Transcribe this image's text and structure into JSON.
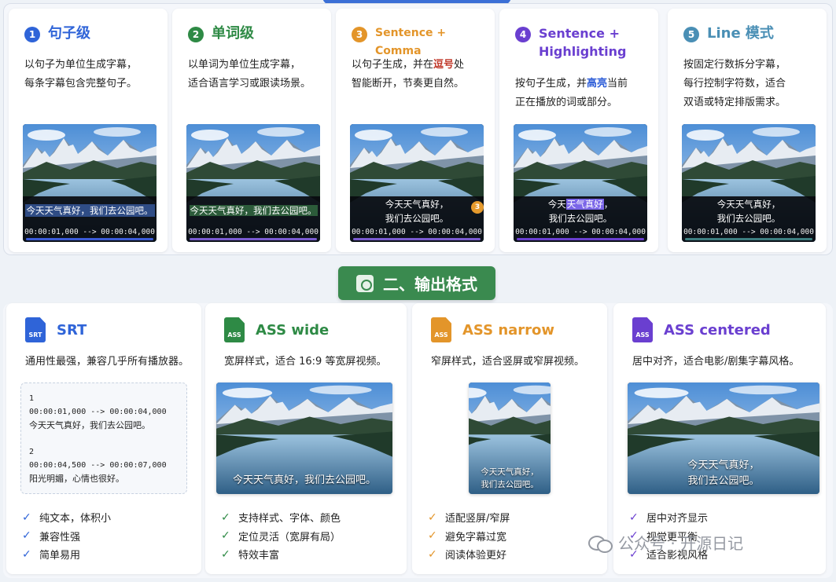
{
  "modes": [
    {
      "num": "1",
      "title": "句子级",
      "color": "#2f64d8",
      "title_size": 18,
      "desc": [
        "以句子为单位生成字幕，",
        "每条字幕包含完整句子。"
      ],
      "subs": [
        "今天天气真好，我们去公园吧。"
      ],
      "time": "00:00:01,000 --> 00:00:04,000",
      "bar": "#3b5bd6"
    },
    {
      "num": "2",
      "title": "单词级",
      "color": "#2e8a45",
      "title_size": 18,
      "desc_rich": [
        [
          "以单词为",
          "",
          ""
        ],
        [
          "单位生成字幕",
          "dark",
          ""
        ],
        [
          "，",
          "",
          ""
        ]
      ],
      "desc": [
        "以单词为单位生成字幕，",
        "适合语言学习或跟读场景。"
      ],
      "subs": [
        "今天天气真好，我们去公园吧。"
      ],
      "time": "00:00:01,000 --> 00:00:04,000",
      "bar": "#7a5bd0"
    },
    {
      "num": "3",
      "title": "Sentence + Comma",
      "color": "#e3952a",
      "title_size": 14,
      "desc_pre": "以句子生成，并在",
      "desc_hl": "逗号",
      "desc_post": "处",
      "desc": [
        "以句子生成，并在逗号处",
        "智能断开，节奏更自然。"
      ],
      "subs": [
        "今天天气真好，",
        "我们去公园吧。"
      ],
      "time": "00:00:01,000 --> 00:00:04,000",
      "bar": "#7a5bd0",
      "badge": "3"
    },
    {
      "num": "4",
      "title": "Sentence +\nHighlighting",
      "color": "#6a3fd0",
      "title_size": 16,
      "desc_pre": "按句子生成，并",
      "desc_hl": "高亮",
      "desc_post": "当前",
      "desc": [
        "按句子生成，并高亮当前",
        "正在播放的词或部分。"
      ],
      "subs_pre": "今天",
      "subs_hl": "天气真好",
      "subs_post": "，",
      "subs2": "我们去公园吧。",
      "subs": [
        "今天天气真好，",
        "我们去公园吧。"
      ],
      "time": "00:00:01,000 --> 00:00:04,000",
      "bar": "#6a3fd0"
    },
    {
      "num": "5",
      "title": "Line 模式",
      "color": "#4a8fb5",
      "title_size": 18,
      "desc": [
        "按固定行数拆分字幕，",
        "每行控制字符数，适合",
        "双语或特定排版需求。"
      ],
      "subs": [
        "今天天气真好，",
        "我们去公园吧。"
      ],
      "time": "00:00:01,000 --> 00:00:04,000",
      "bar": "#3d7e80"
    }
  ],
  "section2": {
    "title": "二、输出格式"
  },
  "formats": [
    {
      "key": "SRT",
      "title": "SRT",
      "icon_label": "SRT",
      "color": "#2f64d8",
      "desc": "通用性最强，兼容几乎所有播放器。",
      "checks": [
        "纯文本，体积小",
        "兼容性强",
        "简单易用"
      ]
    },
    {
      "key": "ASS",
      "title": "ASS wide",
      "icon_label": "ASS",
      "color": "#2e8a45",
      "desc": "宽屏样式，适合 16:9 等宽屏视频。",
      "checks": [
        "支持样式、字体、颜色",
        "定位灵活（宽屏有局）",
        "特效丰富"
      ],
      "subs": [
        "今天天气真好，我们去公园吧。"
      ]
    },
    {
      "key": "ASS",
      "title": "ASS narrow",
      "icon_label": "ASS",
      "color": "#e3952a",
      "desc": "窄屏样式，适合竖屏或窄屏视频。",
      "checks": [
        "适配竖屏/窄屏",
        "避免字幕过宽",
        "阅读体验更好"
      ],
      "subs": [
        "今天天气真好，",
        "我们去公园吧。"
      ]
    },
    {
      "key": "ASS",
      "title": "ASS centered",
      "icon_label": "ASS",
      "color": "#6a3fd0",
      "desc": "居中对齐，适合电影/剧集字幕风格。",
      "checks": [
        "居中对齐显示",
        "视觉更平衡",
        "适合影视风格"
      ],
      "subs": [
        "今天天气真好，",
        "我们去公园吧。"
      ]
    }
  ],
  "srt_code": [
    "1",
    "00:00:01,000 --> 00:00:04,000",
    "今天天气真好，我们去公园吧。",
    "",
    "2",
    "00:00:04,500 --> 00:00:07,000",
    "阳光明媚，心情也很好。"
  ],
  "watermark": "公众号 · 开源日记"
}
